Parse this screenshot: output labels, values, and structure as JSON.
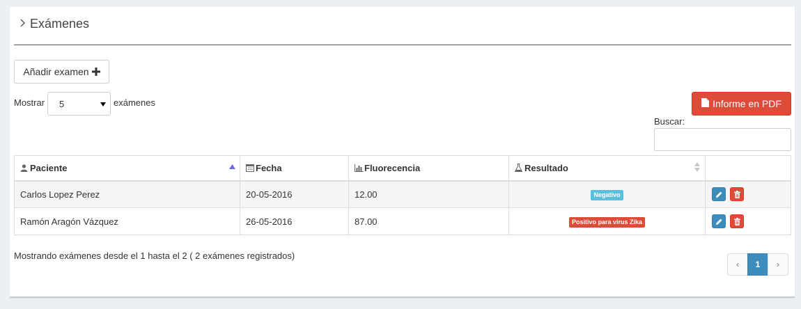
{
  "panel": {
    "title": "Exámenes"
  },
  "toolbar": {
    "add_label": "Añadir examen",
    "pdf_label": "Informe en PDF"
  },
  "length": {
    "prefix": "Mostrar",
    "value": "5",
    "suffix": "exámenes"
  },
  "search": {
    "label": "Buscar:",
    "value": ""
  },
  "table": {
    "columns": [
      {
        "label": "Paciente",
        "icon": "user-icon",
        "sort": "asc"
      },
      {
        "label": "Fecha",
        "icon": "calendar-icon",
        "sort": "none"
      },
      {
        "label": "Fluorecencia",
        "icon": "bar-chart-icon",
        "sort": "none"
      },
      {
        "label": "Resultado",
        "icon": "flask-icon",
        "sort": "both"
      },
      {
        "label": "",
        "icon": "",
        "sort": "none"
      }
    ],
    "rows": [
      {
        "paciente": "Carlos Lopez Perez",
        "fecha": "20-05-2016",
        "fluorecencia": "12.00",
        "resultado": "Negativo",
        "resultado_color": "#5bc0de"
      },
      {
        "paciente": "Ramón Aragón Vázquez",
        "fecha": "26-05-2016",
        "fluorecencia": "87.00",
        "resultado": "Positivo para virus Zika",
        "resultado_color": "#dd4b39"
      }
    ]
  },
  "footer": {
    "info": "Mostrando exámenes desde el 1 hasta el 2 ( 2 exámenes registrados)",
    "pager": {
      "prev": "‹",
      "current": "1",
      "next": "›"
    }
  },
  "colors": {
    "primary": "#3c8dbc",
    "danger": "#dd4b39",
    "info": "#5bc0de"
  }
}
